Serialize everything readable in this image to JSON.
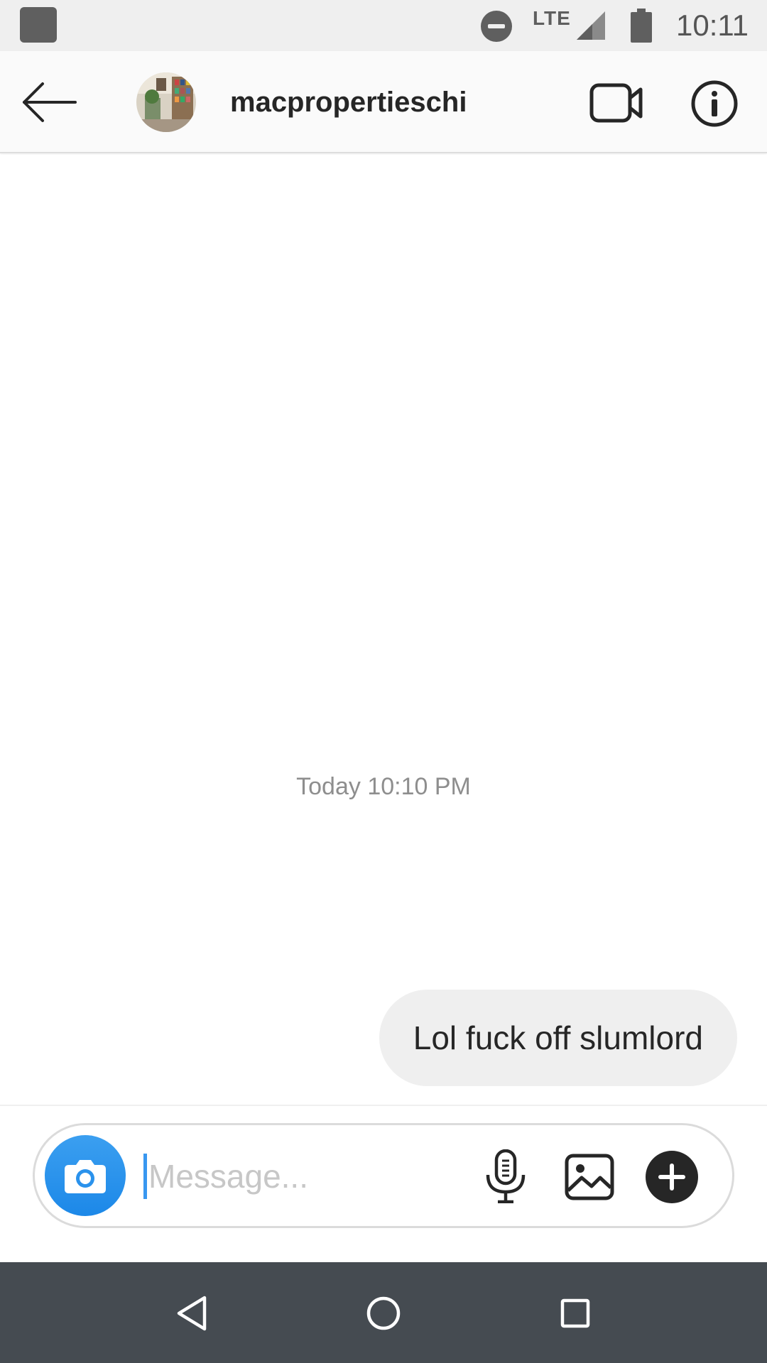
{
  "status_bar": {
    "time": "10:11",
    "network": "LTE",
    "icons": [
      "app-square-icon",
      "do-not-disturb-icon",
      "signal-icon",
      "battery-icon"
    ]
  },
  "header": {
    "username": "macpropertieschi",
    "icons": [
      "back-arrow-icon",
      "avatar",
      "video-call-icon",
      "info-icon"
    ]
  },
  "thread": {
    "timestamp": "Today 10:10 PM",
    "messages": [
      {
        "sender": "self",
        "text": "Lol fuck off slumlord"
      }
    ]
  },
  "composer": {
    "placeholder": "Message...",
    "value": "",
    "icons": [
      "camera-icon",
      "microphone-icon",
      "gallery-icon",
      "plus-icon"
    ]
  },
  "nav_bar": {
    "icons": [
      "back-triangle-icon",
      "home-circle-icon",
      "recents-square-icon"
    ]
  },
  "colors": {
    "accent_blue": "#3897f0",
    "bubble_bg": "#efefef",
    "text_dark": "#262626",
    "text_muted": "#8e8e8e",
    "nav_bg": "#454b51"
  }
}
